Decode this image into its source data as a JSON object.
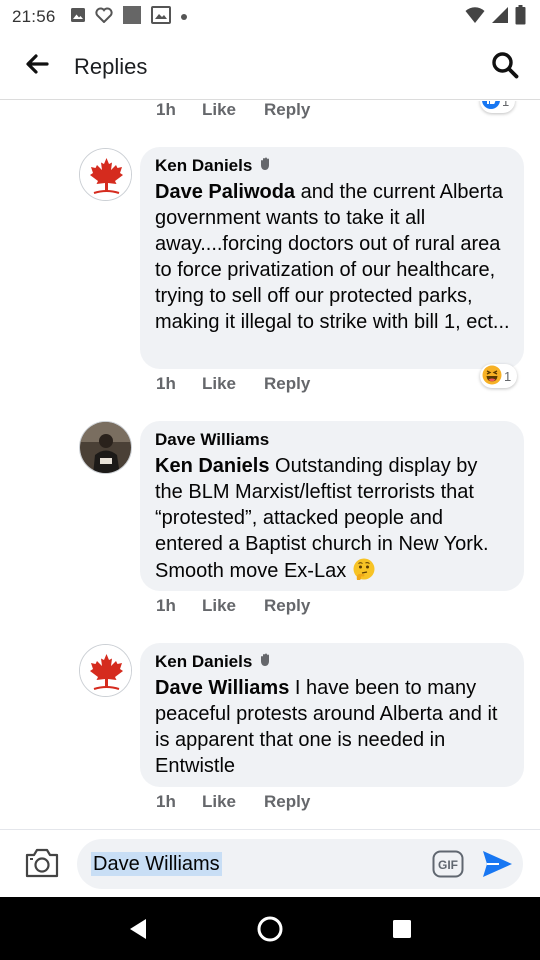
{
  "status_bar": {
    "time": "21:56"
  },
  "header": {
    "title": "Replies"
  },
  "top_fragment": {
    "time": "1h",
    "like": "Like",
    "reply": "Reply",
    "reaction_count": "1"
  },
  "comments": [
    {
      "author": "Ken Daniels",
      "mention": "Dave Paliwoda",
      "text": " and the current Alberta government wants to take it all away....forcing doctors out of rural area to force privatization of our healthcare, trying to sell off our protected parks, making it illegal to strike with bill 1, ect...",
      "time": "1h",
      "like": "Like",
      "reply": "Reply",
      "reaction_count": "1"
    },
    {
      "author": "Dave Williams",
      "mention": "Ken Daniels",
      "text": " Outstanding display by the BLM Marxist/leftist terrorists that “protested”, attacked people and entered a Baptist church in New York. Smooth move Ex-Lax",
      "time": "1h",
      "like": "Like",
      "reply": "Reply"
    },
    {
      "author": "Ken Daniels",
      "mention": "Dave Williams",
      "text": " I have been to many peaceful protests around Alberta and it is apparent that one is needed in Entwistle",
      "time": "1h",
      "like": "Like",
      "reply": "Reply"
    }
  ],
  "composer": {
    "value": "Dave Williams",
    "gif_label": "GIF"
  },
  "colors": {
    "accent": "#1877f2",
    "bubble": "#f0f2f5",
    "meta": "#65676b",
    "flag_red": "#d52b1e"
  }
}
